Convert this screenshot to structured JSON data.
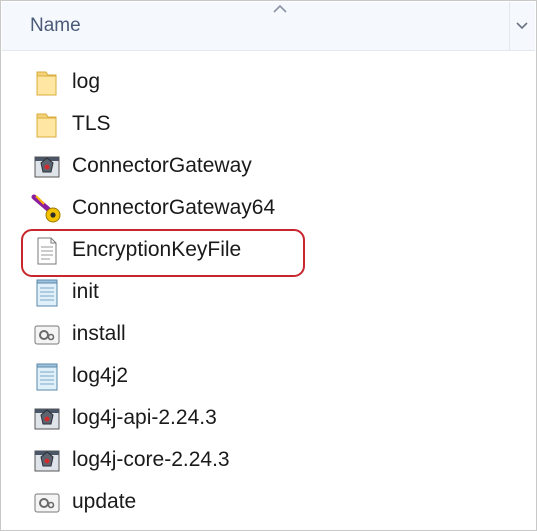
{
  "header": {
    "name_label": "Name"
  },
  "files": [
    {
      "name": "log",
      "icon": "folder-icon"
    },
    {
      "name": "TLS",
      "icon": "folder-icon"
    },
    {
      "name": "ConnectorGateway",
      "icon": "app-exe-icon"
    },
    {
      "name": "ConnectorGateway64",
      "icon": "app-exe-64-icon"
    },
    {
      "name": "EncryptionKeyFile",
      "icon": "text-document-icon"
    },
    {
      "name": "init",
      "icon": "notepad-icon"
    },
    {
      "name": "install",
      "icon": "settings-file-icon"
    },
    {
      "name": "log4j2",
      "icon": "notepad-icon"
    },
    {
      "name": "log4j-api-2.24.3",
      "icon": "java-archive-icon"
    },
    {
      "name": "log4j-core-2.24.3",
      "icon": "java-archive-icon"
    },
    {
      "name": "update",
      "icon": "settings-file-icon"
    }
  ],
  "highlight_color": "#c8262d",
  "header_text_color": "#4a5a78"
}
